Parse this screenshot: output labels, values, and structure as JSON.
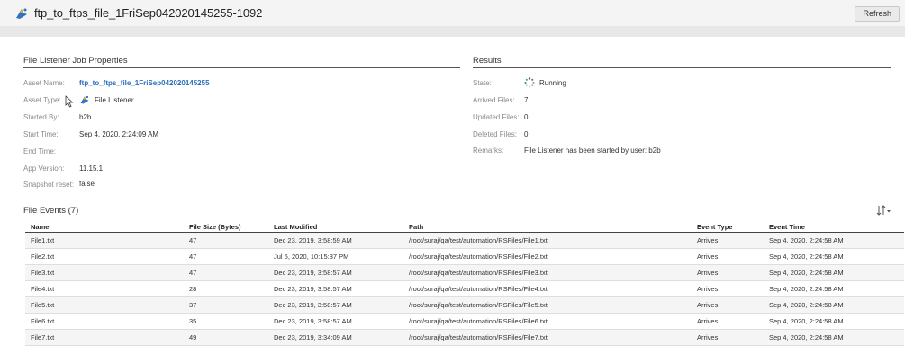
{
  "header": {
    "title": "ftp_to_ftps_file_1FriSep042020145255-1092",
    "title_icon": "file-listener-icon",
    "refresh_label": "Refresh"
  },
  "job_properties": {
    "section_title": "File Listener Job Properties",
    "fields": [
      {
        "label": "Asset Name:",
        "value": "ftp_to_ftps_file_1FriSep042020145255"
      },
      {
        "label": "Asset Type:",
        "value": "File Listener"
      },
      {
        "label": "Started By:",
        "value": "b2b"
      },
      {
        "label": "Start Time:",
        "value": "Sep 4, 2020, 2:24:09 AM"
      },
      {
        "label": "End Time:",
        "value": ""
      },
      {
        "label": "App Version:",
        "value": "11.15.1"
      },
      {
        "label": "Snapshot reset:",
        "value": "false"
      }
    ]
  },
  "results": {
    "section_title": "Results",
    "fields": [
      {
        "label": "State:",
        "value": "Running"
      },
      {
        "label": "Arrived Files:",
        "value": "7"
      },
      {
        "label": "Updated Files:",
        "value": "0"
      },
      {
        "label": "Deleted Files:",
        "value": "0"
      },
      {
        "label": "Remarks:",
        "value": "File Listener has been started by user: b2b"
      }
    ]
  },
  "file_events": {
    "section_title": "File Events (7)",
    "sort_icon": "sort-icon",
    "columns": [
      "Name",
      "File Size (Bytes)",
      "Last Modified",
      "Path",
      "Event Type",
      "Event Time"
    ],
    "rows": [
      [
        "File1.txt",
        "47",
        "Dec 23, 2019, 3:58:59 AM",
        "/root/suraj/qa/test/automation/RSFiles/File1.txt",
        "Arrives",
        "Sep 4, 2020, 2:24:58 AM"
      ],
      [
        "File2.txt",
        "47",
        "Jul 5, 2020, 10:15:37 PM",
        "/root/suraj/qa/test/automation/RSFiles/File2.txt",
        "Arrives",
        "Sep 4, 2020, 2:24:58 AM"
      ],
      [
        "File3.txt",
        "47",
        "Dec 23, 2019, 3:58:57 AM",
        "/root/suraj/qa/test/automation/RSFiles/File3.txt",
        "Arrives",
        "Sep 4, 2020, 2:24:58 AM"
      ],
      [
        "File4.txt",
        "28",
        "Dec 23, 2019, 3:58:57 AM",
        "/root/suraj/qa/test/automation/RSFiles/File4.txt",
        "Arrives",
        "Sep 4, 2020, 2:24:58 AM"
      ],
      [
        "File5.txt",
        "37",
        "Dec 23, 2019, 3:58:57 AM",
        "/root/suraj/qa/test/automation/RSFiles/File5.txt",
        "Arrives",
        "Sep 4, 2020, 2:24:58 AM"
      ],
      [
        "File6.txt",
        "35",
        "Dec 23, 2019, 3:58:57 AM",
        "/root/suraj/qa/test/automation/RSFiles/File6.txt",
        "Arrives",
        "Sep 4, 2020, 2:24:58 AM"
      ],
      [
        "File7.txt",
        "49",
        "Dec 23, 2019, 3:34:09 AM",
        "/root/suraj/qa/test/automation/RSFiles/File7.txt",
        "Arrives",
        "Sep 4, 2020, 2:24:58 AM"
      ]
    ]
  },
  "colors": {
    "link": "#2a6ebb",
    "icon_blue": "#2f74c0",
    "icon_orange": "#f2a31b"
  }
}
